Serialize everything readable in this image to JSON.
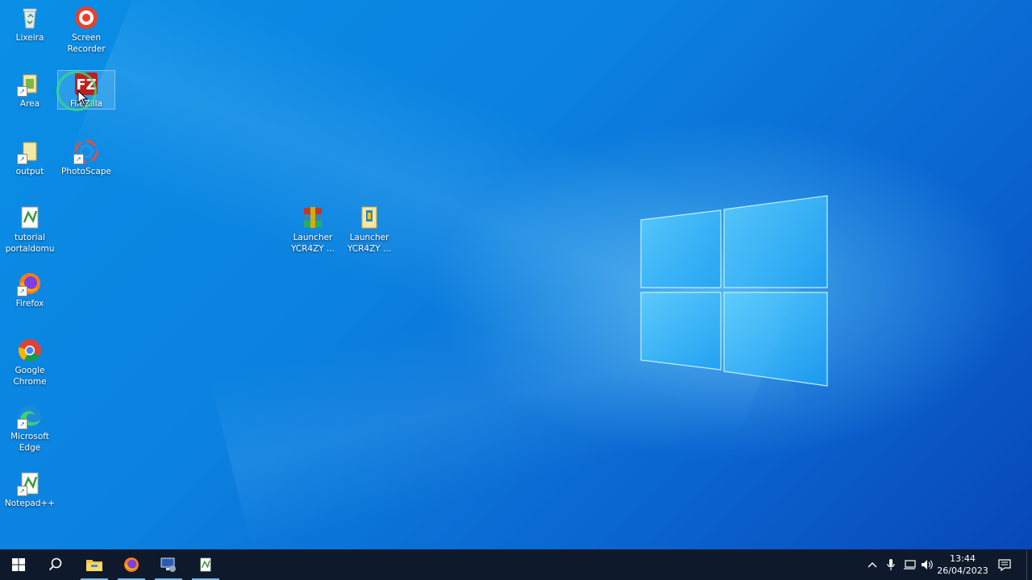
{
  "desktop_icons": [
    {
      "name": "Lixeira",
      "icon": "recycle-bin-icon"
    },
    {
      "name": "Screen\nRecorder",
      "icon": "screen-recorder-icon"
    },
    {
      "name": "Area",
      "icon": "folder-icon"
    },
    {
      "name": "FileZilla",
      "icon": "filezilla-icon"
    },
    {
      "name": "output",
      "icon": "folder-icon"
    },
    {
      "name": "PhotoScape",
      "icon": "photoscape-icon"
    },
    {
      "name": "tutorial\nportaldomu",
      "icon": "notepadpp-file-icon"
    },
    {
      "name": "Firefox",
      "icon": "firefox-icon"
    },
    {
      "name": "Google\nChrome",
      "icon": "chrome-icon"
    },
    {
      "name": "Microsoft\nEdge",
      "icon": "edge-icon"
    },
    {
      "name": "Notepad++",
      "icon": "notepadpp-icon"
    },
    {
      "name": "Launcher\nYCR4ZY ...",
      "icon": "winrar-archive-icon"
    },
    {
      "name": "Launcher\nYCR4ZY ...",
      "icon": "launcher-file-icon"
    }
  ],
  "taskbar": {
    "items": [
      "start-icon",
      "search-icon",
      "file-explorer-icon",
      "firefox-icon",
      "network-app-icon",
      "notepadpp-icon"
    ],
    "time": "13:44",
    "date": "26/04/2023"
  },
  "colors": {
    "desktop_blue": "#0b82e0",
    "taskbar": "#0e1a2b",
    "accent": "#76b9ed"
  }
}
